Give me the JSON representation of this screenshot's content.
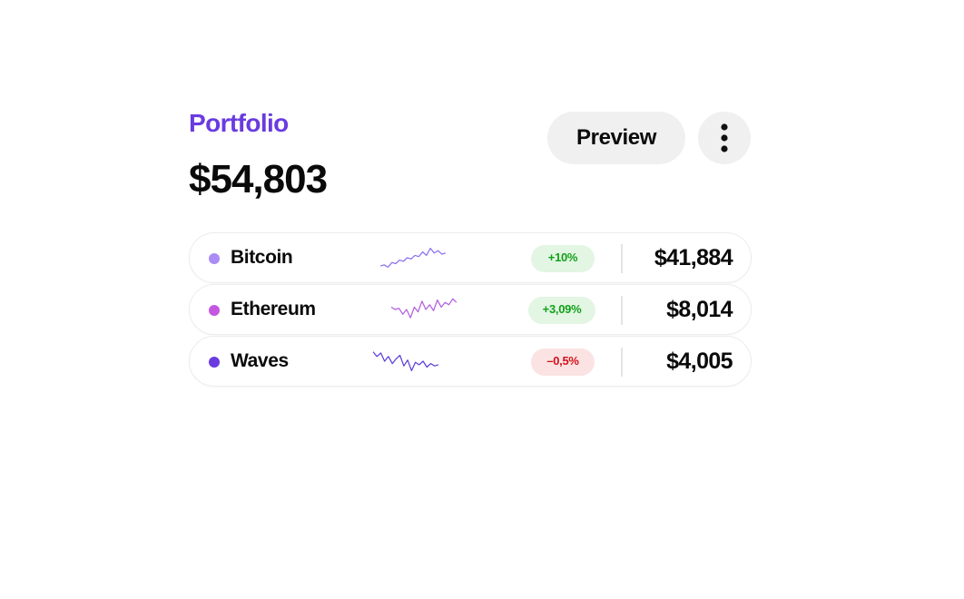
{
  "portfolio": {
    "title": "Portfolio",
    "total": "$54,803",
    "accent_color": "#6a3be0"
  },
  "actions": {
    "preview_label": "Preview",
    "more_icon": "more-vertical-icon"
  },
  "assets": [
    {
      "name": "Bitcoin",
      "dot_color": "#a98cf5",
      "change": "+10%",
      "trend": "up",
      "value": "$41,884",
      "sparkline": [
        0.15,
        0.2,
        0.1,
        0.3,
        0.25,
        0.4,
        0.35,
        0.5,
        0.45,
        0.6,
        0.55,
        0.75,
        0.6,
        0.9,
        0.7,
        0.8,
        0.65,
        0.7
      ],
      "spark_color": "#8a6cf0"
    },
    {
      "name": "Ethereum",
      "dot_color": "#c456e0",
      "change": "+3,09%",
      "trend": "up",
      "value": "$8,014",
      "sparkline": [
        0.6,
        0.5,
        0.55,
        0.3,
        0.5,
        0.15,
        0.6,
        0.4,
        0.85,
        0.5,
        0.7,
        0.45,
        0.9,
        0.6,
        0.8,
        0.7,
        0.95,
        0.8
      ],
      "spark_color": "#b05ae0"
    },
    {
      "name": "Waves",
      "dot_color": "#6a3be0",
      "change": "–0,5%",
      "trend": "down",
      "value": "$4,005",
      "sparkline": [
        0.9,
        0.7,
        0.85,
        0.5,
        0.7,
        0.4,
        0.6,
        0.75,
        0.3,
        0.55,
        0.1,
        0.45,
        0.35,
        0.5,
        0.25,
        0.4,
        0.3,
        0.35
      ],
      "spark_color": "#5a3ad8"
    }
  ]
}
